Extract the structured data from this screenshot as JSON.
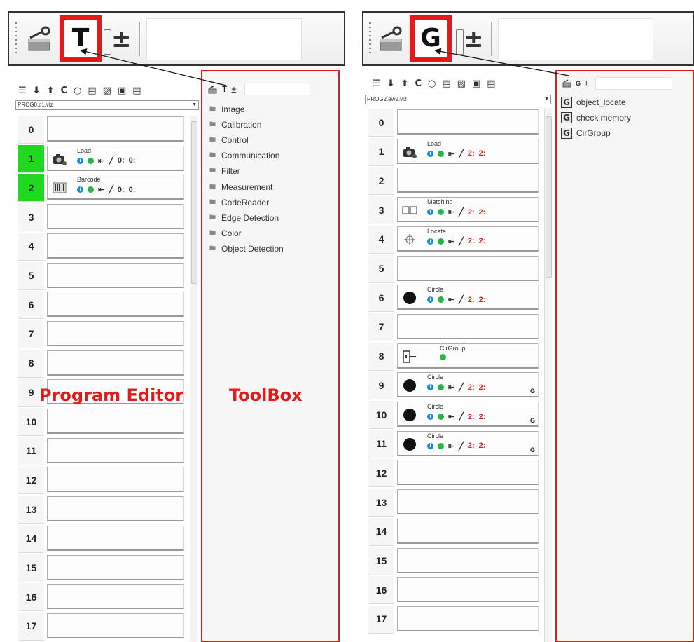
{
  "left_panel": {
    "top_toolbar": {
      "highlight_letter": "T",
      "plusminus": "±"
    },
    "small_toolbar_icons": [
      "list-icon",
      "download-icon",
      "upload-icon",
      "refresh-icon",
      "circle-icon",
      "copy-icon",
      "edit-icon",
      "save-icon",
      "preview-icon"
    ],
    "small_toolbar_glyphs": [
      "☰",
      "⬇",
      "⬆",
      "C",
      "○",
      "▤",
      "▨",
      "▣",
      "▤"
    ],
    "program_file": "PROG0.c1.viz",
    "rows": [
      {
        "num": "0"
      },
      {
        "num": "1",
        "highlighted": true,
        "op": {
          "name": "Load",
          "icon": "camera-icon",
          "ctrls": [
            "0:",
            "0:"
          ]
        }
      },
      {
        "num": "2",
        "highlighted": true,
        "op": {
          "name": "Barcode",
          "icon": "barcode-icon",
          "ctrls": [
            "0:",
            "0:"
          ]
        }
      },
      {
        "num": "3"
      },
      {
        "num": "4"
      },
      {
        "num": "5"
      },
      {
        "num": "6"
      },
      {
        "num": "7"
      },
      {
        "num": "8"
      },
      {
        "num": "9"
      },
      {
        "num": "10"
      },
      {
        "num": "11"
      },
      {
        "num": "12"
      },
      {
        "num": "13"
      },
      {
        "num": "14"
      },
      {
        "num": "15"
      },
      {
        "num": "16"
      },
      {
        "num": "17"
      }
    ],
    "label_program_editor": "Program Editor",
    "toolbox": {
      "header_T": "T",
      "header_pm": "±",
      "items": [
        "Image",
        "Calibration",
        "Control",
        "Communication",
        "Filter",
        "Measurement",
        "CodeReader",
        "Edge Detection",
        "Color",
        "Object Detection"
      ]
    },
    "label_toolbox": "ToolBox"
  },
  "right_panel": {
    "top_toolbar": {
      "highlight_letter": "G",
      "plusminus": "±"
    },
    "small_toolbar_glyphs": [
      "☰",
      "⬇",
      "⬆",
      "C",
      "○",
      "▤",
      "▨",
      "▣",
      "▤"
    ],
    "program_file": "PROG2.ew2.viz",
    "rows": [
      {
        "num": "0"
      },
      {
        "num": "1",
        "op": {
          "name": "Load",
          "icon": "camera-icon",
          "ctrls": [
            "2:",
            "2:"
          ]
        }
      },
      {
        "num": "2"
      },
      {
        "num": "3",
        "op": {
          "name": "Matching",
          "icon": "matching-icon",
          "ctrls": [
            "2:",
            "2:"
          ]
        }
      },
      {
        "num": "4",
        "op": {
          "name": "Locate",
          "icon": "locate-icon",
          "ctrls": [
            "2:",
            "2:"
          ]
        }
      },
      {
        "num": "5"
      },
      {
        "num": "6",
        "op": {
          "name": "Circle",
          "icon": "circle-icon",
          "ctrls": [
            "2:",
            "2:"
          ]
        }
      },
      {
        "num": "7"
      },
      {
        "num": "8",
        "op": {
          "name": "CirGroup",
          "icon": "group-icon",
          "simple": true
        }
      },
      {
        "num": "9",
        "op": {
          "name": "Circle",
          "icon": "circle-icon",
          "ctrls": [
            "2:",
            "2:"
          ],
          "g": "G"
        }
      },
      {
        "num": "10",
        "op": {
          "name": "Circle",
          "icon": "circle-icon",
          "ctrls": [
            "2:",
            "2:"
          ],
          "g": "G"
        }
      },
      {
        "num": "11",
        "op": {
          "name": "Circle",
          "icon": "circle-icon",
          "ctrls": [
            "2:",
            "2:"
          ],
          "g": "G"
        }
      },
      {
        "num": "12"
      },
      {
        "num": "13"
      },
      {
        "num": "14"
      },
      {
        "num": "15"
      },
      {
        "num": "16"
      },
      {
        "num": "17"
      }
    ],
    "groups_header_G": "G",
    "groups_header_pm": "±",
    "groups": [
      {
        "icon": "G",
        "label": "object_locate"
      },
      {
        "icon": "G",
        "label": "check memory"
      },
      {
        "icon": "G",
        "label": "CirGroup"
      }
    ]
  }
}
